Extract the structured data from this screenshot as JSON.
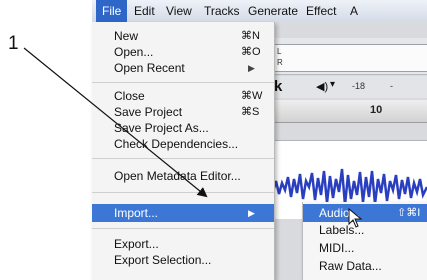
{
  "callout": {
    "number": "1"
  },
  "menubar": {
    "items": [
      "File",
      "Edit",
      "View",
      "Tracks",
      "Generate",
      "Effect",
      "A"
    ]
  },
  "file_menu": {
    "items": [
      {
        "label": "New",
        "shortcut": "⌘N"
      },
      {
        "label": "Open...",
        "shortcut": "⌘O"
      },
      {
        "label": "Open Recent",
        "shortcut": "▶"
      },
      {
        "label": "Close",
        "shortcut": "⌘W"
      },
      {
        "label": "Save Project",
        "shortcut": "⌘S"
      },
      {
        "label": "Save Project As...",
        "shortcut": ""
      },
      {
        "label": "Check Dependencies...",
        "shortcut": ""
      },
      {
        "label": "Open Metadata Editor...",
        "shortcut": ""
      },
      {
        "label": "Import...",
        "shortcut": "▶"
      },
      {
        "label": "Export...",
        "shortcut": ""
      },
      {
        "label": "Export Selection...",
        "shortcut": ""
      }
    ]
  },
  "import_submenu": {
    "items": [
      {
        "label": "Audio...",
        "shortcut": "⇧⌘I"
      },
      {
        "label": "Labels...",
        "shortcut": ""
      },
      {
        "label": "MIDI...",
        "shortcut": ""
      },
      {
        "label": "Raw Data...",
        "shortcut": ""
      }
    ]
  },
  "background_app": {
    "meter_labels": [
      "L",
      "R"
    ],
    "toolbar_glyph": "k",
    "volume_icon": "◀)",
    "volume_dropdown": "▾",
    "db_values": [
      "-18",
      "-"
    ],
    "ruler_tick": "10"
  },
  "colors": {
    "menu_highlight": "#3d77d6",
    "menubar_active": "#2f67c9",
    "waveform": "#2a3fbf"
  }
}
